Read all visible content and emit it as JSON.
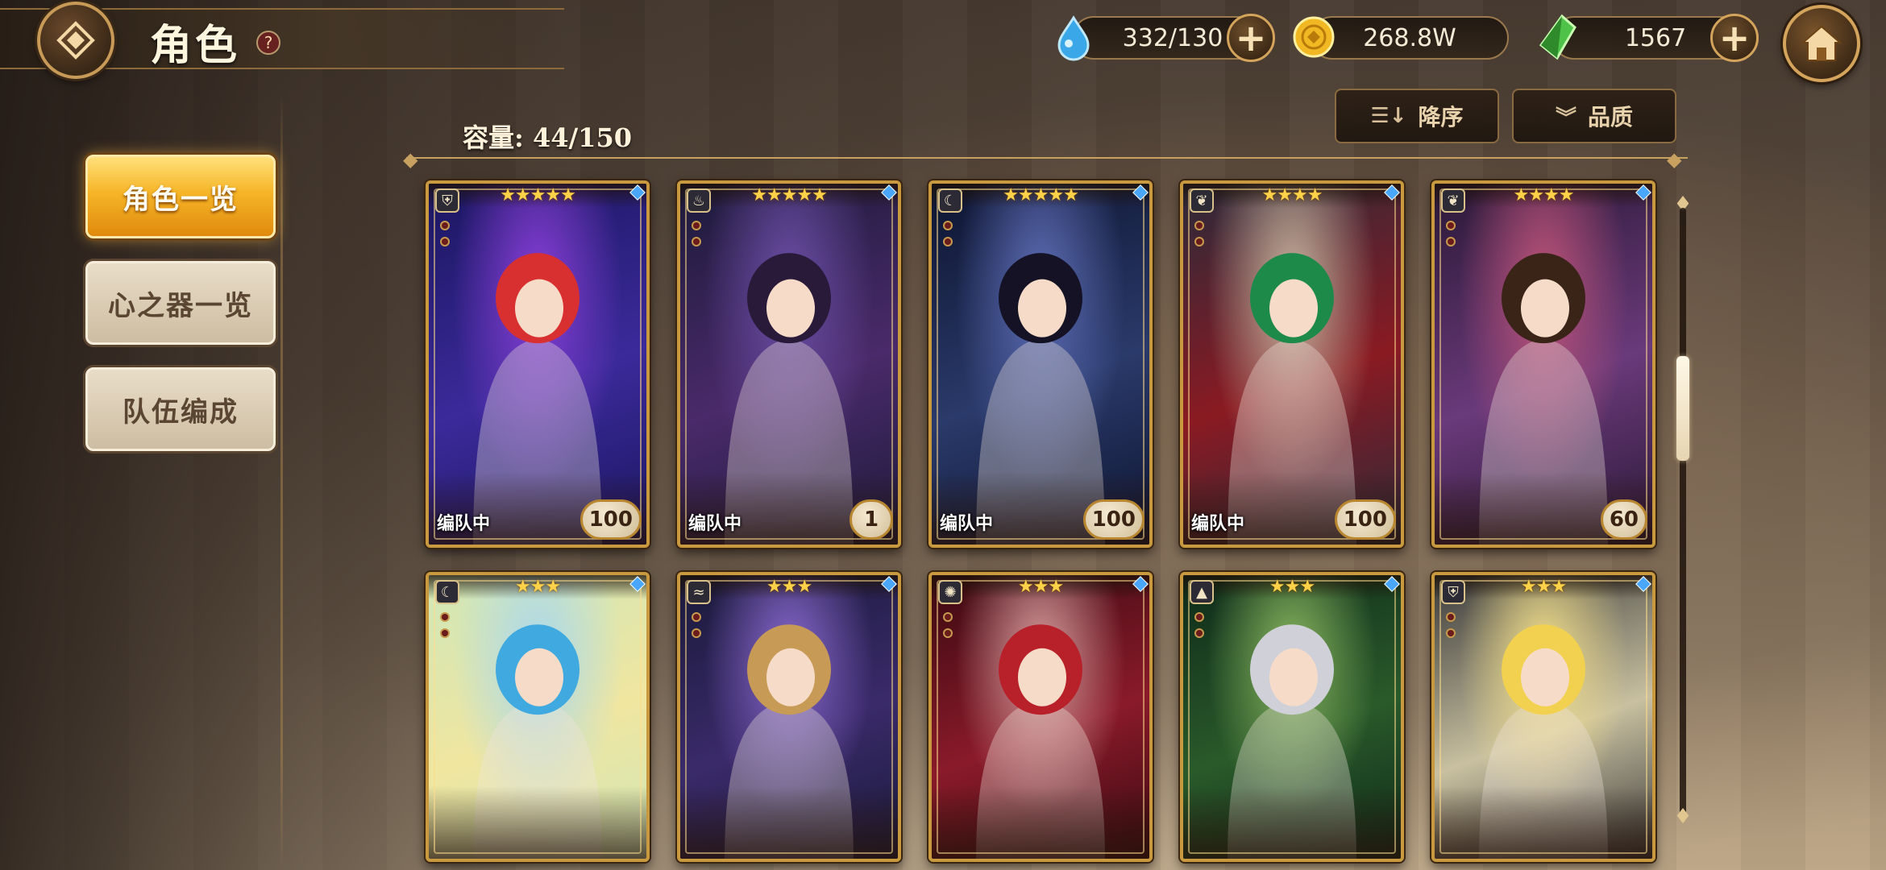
{
  "header": {
    "title": "角色",
    "help_glyph": "?",
    "back_icon": "diamond-back-icon",
    "home_icon": "home-icon"
  },
  "resources": {
    "stamina": {
      "icon": "water-drop-icon",
      "value": "332/130",
      "color": "#3aa8e8"
    },
    "gold": {
      "icon": "gold-coin-icon",
      "value": "268.8W",
      "color": "#f2b823"
    },
    "gems": {
      "icon": "green-crystal-icon",
      "value": "1567",
      "color": "#4fc24a"
    },
    "plus_glyph": "+"
  },
  "sidebar": {
    "items": [
      {
        "label": "角色一览",
        "active": true
      },
      {
        "label": "心之器一览",
        "active": false
      },
      {
        "label": "队伍编成",
        "active": false
      }
    ]
  },
  "toolbar": {
    "capacity": "容量: 44/150",
    "sort_label": "降序",
    "sort_icon": "sort-descending-icon",
    "filter_label": "品质",
    "filter_icon": "chevron-double-down-icon"
  },
  "cards": [
    {
      "stars": "★★★★★",
      "level": "100",
      "team": "编队中",
      "element": "dark",
      "class_icon": "shield-class-icon",
      "hair": "#d83030",
      "palette": [
        "#1b1660",
        "#3b2a9a",
        "#8a3fd8"
      ]
    },
    {
      "stars": "★★★★★",
      "level": "1",
      "team": "编队中",
      "element": "fire",
      "class_icon": "flame-class-icon",
      "hair": "#2a1a3a",
      "palette": [
        "#1c1a3a",
        "#4a2a6a",
        "#6d4fa8"
      ]
    },
    {
      "stars": "★★★★★",
      "level": "100",
      "team": "编队中",
      "element": "light",
      "class_icon": "moon-class-icon",
      "hair": "#141224",
      "palette": [
        "#0e1430",
        "#2a3a6a",
        "#5e6eb8"
      ]
    },
    {
      "stars": "★★★★",
      "level": "100",
      "team": "编队中",
      "element": "wind",
      "class_icon": "leaf-class-icon",
      "hair": "#1d8a4a",
      "palette": [
        "#2a2a3a",
        "#8a1a22",
        "#c8b6a0"
      ]
    },
    {
      "stars": "★★★★",
      "level": "60",
      "team": "",
      "element": "wind",
      "class_icon": "leaf-class-icon",
      "hair": "#3a2418",
      "palette": [
        "#2a1836",
        "#6a3a7a",
        "#c0547a"
      ]
    },
    {
      "stars": "★★★",
      "level": "",
      "team": "",
      "element": "dark",
      "class_icon": "moon-class-icon",
      "hair": "#3fa9e0",
      "palette": [
        "#cfe7b8",
        "#f0e6a0",
        "#a8d8f0"
      ]
    },
    {
      "stars": "★★★",
      "level": "",
      "team": "",
      "element": "water",
      "class_icon": "wave-class-icon",
      "hair": "#c79a56",
      "palette": [
        "#1a1a3a",
        "#3a2a6a",
        "#8a6ad0"
      ]
    },
    {
      "stars": "★★★",
      "level": "",
      "team": "",
      "element": "light",
      "class_icon": "sun-class-icon",
      "hair": "#b8202a",
      "palette": [
        "#3a0a12",
        "#8a1a2a",
        "#d8a0a0"
      ]
    },
    {
      "stars": "★★★",
      "level": "",
      "team": "",
      "element": "earth",
      "class_icon": "mountain-class-icon",
      "hair": "#d0d0d8",
      "palette": [
        "#0e2a1a",
        "#2a5a2a",
        "#8ab860"
      ]
    },
    {
      "stars": "★★★",
      "level": "",
      "team": "",
      "element": "dark",
      "class_icon": "shield-class-icon",
      "hair": "#f2d050",
      "palette": [
        "#3a3a3a",
        "#c8c0a0",
        "#f4e08a"
      ]
    }
  ]
}
